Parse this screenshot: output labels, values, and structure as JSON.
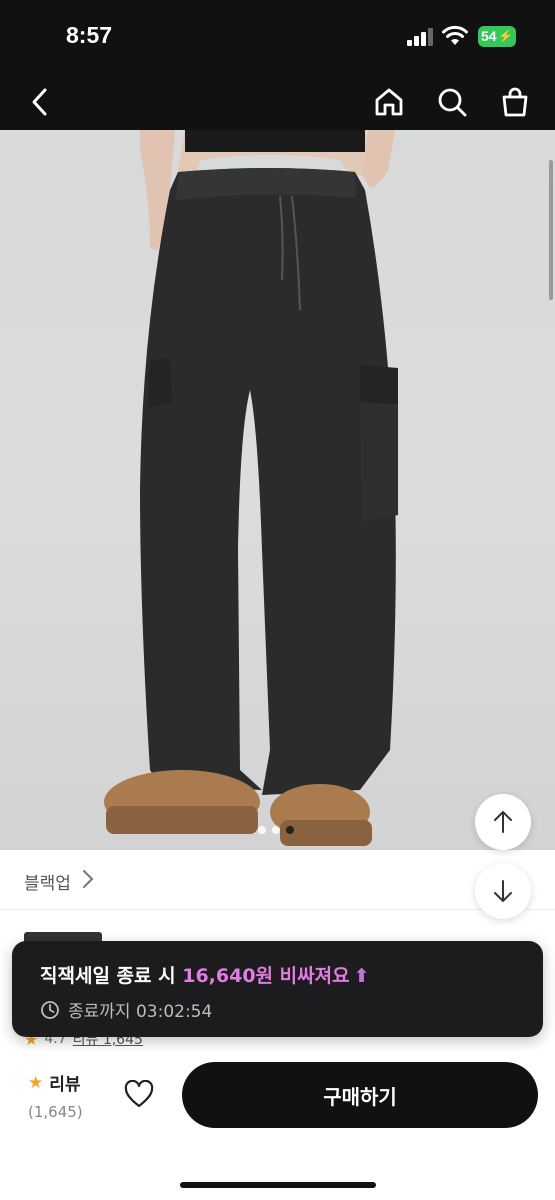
{
  "status_bar": {
    "time": "8:57",
    "battery": "54"
  },
  "nav": {
    "back_icon": "chevron-left-icon",
    "home_icon": "home-icon",
    "search_icon": "search-icon",
    "cart_icon": "shopping-bag-icon"
  },
  "gallery": {
    "total_images": 3,
    "active_index": 3
  },
  "brand": {
    "name": "블랙업"
  },
  "sale_toast": {
    "title_prefix": "직잭세일 종료 시 ",
    "highlight": "16,640원 비싸져요",
    "arrow": "⬆",
    "timer_label": "종료까지 03:02:54"
  },
  "partial": {
    "rating": "4.7",
    "review_link": "리뷰 1,645"
  },
  "bottom_bar": {
    "review_label": "리뷰",
    "review_count": "(1,645)",
    "buy_label": "구매하기"
  },
  "colors": {
    "header_bg": "#111111",
    "accent_pink": "#e27ce0",
    "star": "#f5a623",
    "battery": "#34c759"
  }
}
